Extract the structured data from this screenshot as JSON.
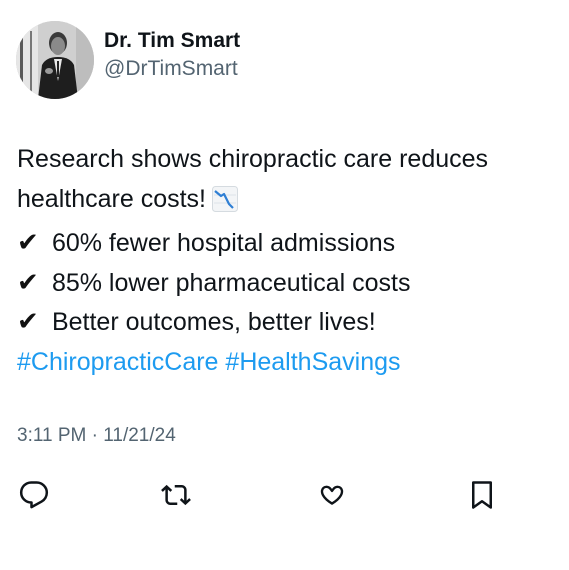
{
  "author": {
    "display_name": "Dr. Tim Smart",
    "handle": "@DrTimSmart"
  },
  "tweet": {
    "lines": [
      "Research shows chiropractic care reduces",
      "healthcare costs!",
      "60% fewer hospital admissions",
      "85% lower pharmaceutical costs",
      "Better outcomes, better lives!"
    ],
    "check_mark": "✔",
    "emoji": "chart-decreasing-icon",
    "hashtags": "#ChiropracticCare #HealthSavings",
    "timestamp": "3:11 PM · 11/21/24"
  },
  "actions": [
    "reply-icon",
    "retweet-icon",
    "like-icon",
    "bookmark-icon"
  ],
  "colors": {
    "text": "#0f1419",
    "secondary": "#536471",
    "link": "#1d9bf0"
  }
}
